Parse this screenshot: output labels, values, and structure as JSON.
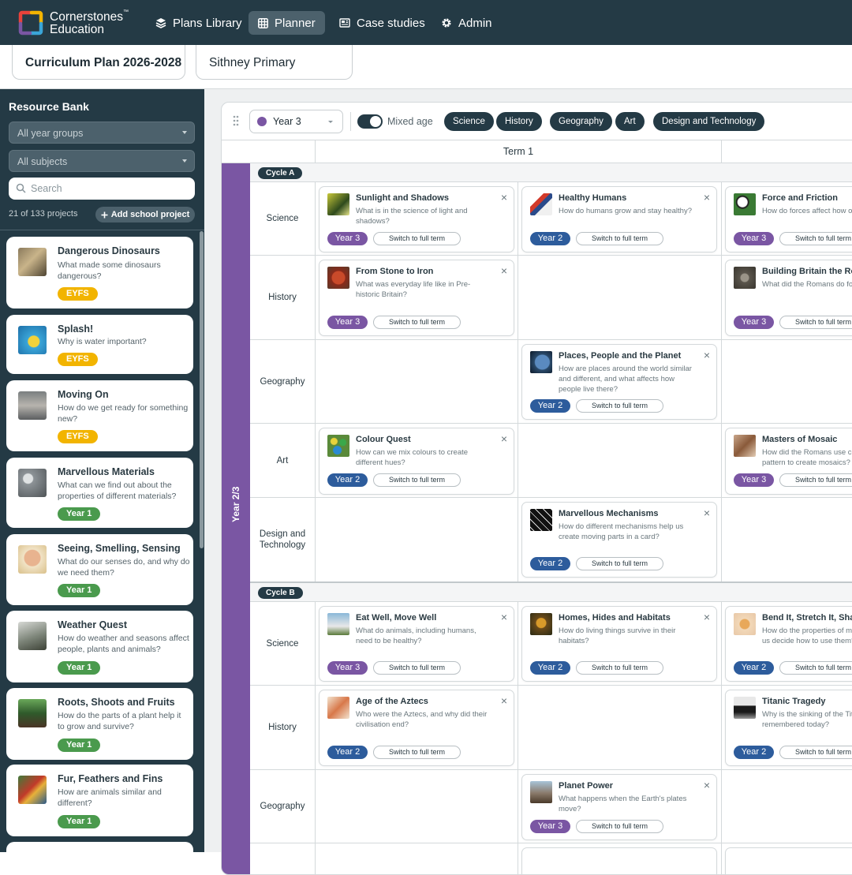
{
  "brand": {
    "line1": "Cornerstones",
    "tm": "™",
    "line2": "Education"
  },
  "nav": [
    {
      "label": "Plans Library",
      "icon": "layers-icon"
    },
    {
      "label": "Planner",
      "icon": "grid-icon",
      "active": true
    },
    {
      "label": "Case studies",
      "icon": "newspaper-icon"
    },
    {
      "label": "Admin",
      "icon": "gear-icon"
    }
  ],
  "plan": {
    "title": "Curriculum Plan 2026-2028",
    "school": "Sithney Primary"
  },
  "sidebar": {
    "title": "Resource Bank",
    "year_filter": "All year groups",
    "subject_filter": "All subjects",
    "search_placeholder": "Search",
    "count": "21 of 133 projects",
    "add_label": "Add school project",
    "items": [
      {
        "title": "Dangerous Dinosaurs",
        "question": "What made some dinosaurs dangerous?",
        "badge": "EYFS"
      },
      {
        "title": "Splash!",
        "question": "Why is water important?",
        "badge": "EYFS"
      },
      {
        "title": "Moving On",
        "question": "How do we get ready for something new?",
        "badge": "EYFS"
      },
      {
        "title": "Marvellous Materials",
        "question": "What can we find out about the properties of different materials?",
        "badge": "Year 1"
      },
      {
        "title": "Seeing, Smelling, Sensing",
        "question": "What do our senses do, and why do we need them?",
        "badge": "Year 1"
      },
      {
        "title": "Weather Quest",
        "question": "How do weather and seasons affect people, plants and animals?",
        "badge": "Year 1"
      },
      {
        "title": "Roots, Shoots and Fruits",
        "question": "How do the parts of a plant help it to grow and survive?",
        "badge": "Year 1"
      },
      {
        "title": "Fur, Feathers and Fins",
        "question": "How are animals similar and different?",
        "badge": "Year 1"
      }
    ]
  },
  "toolbar": {
    "year": "Year 3",
    "mixed_age": "Mixed age",
    "subjects": [
      "Science",
      "History",
      "Geography",
      "Art",
      "Design and Technology"
    ]
  },
  "term": "Term 1",
  "year_band": "Year 2/3",
  "switch_label": "Switch to full term",
  "close_glyph": "×",
  "cycles": [
    {
      "label": "Cycle A",
      "rows": [
        {
          "subject": "Science",
          "cards": [
            {
              "title": "Sunlight and Shadows",
              "question": "What is in the science of light and shadows?",
              "year": "Year 3"
            },
            {
              "title": "Healthy Humans",
              "question": "How do humans grow and stay healthy?",
              "year": "Year 2"
            },
            {
              "title": "Force and Friction",
              "question": "How do forces affect how objects move?",
              "year": "Year 3"
            }
          ]
        },
        {
          "subject": "History",
          "cards": [
            {
              "title": "From Stone to Iron",
              "question": "What was everyday life like in Pre-historic Britain?",
              "year": "Year 3"
            },
            {
              "title": "Building Britain the Romans",
              "question": "What did the Romans do for Britain?",
              "year": "Year 3"
            }
          ]
        },
        {
          "subject": "Geography",
          "cards": [
            {
              "title": "Places, People and the Planet",
              "question": "How are places around the world similar and different, and what affects how people live there?",
              "year": "Year 2"
            }
          ]
        },
        {
          "subject": "Art",
          "cards": [
            {
              "title": "Colour Quest",
              "question": "How can we mix colours to create different hues?",
              "year": "Year 2"
            },
            {
              "title": "Masters of Mosaic",
              "question": "How did the Romans use colour and pattern to create mosaics?",
              "year": "Year 3"
            }
          ]
        },
        {
          "subject": "Design and Technology",
          "cards": [
            {
              "title": "Marvellous Mechanisms",
              "question": "How do different mechanisms help us create moving parts in a card?",
              "year": "Year 2"
            }
          ]
        }
      ]
    },
    {
      "label": "Cycle B",
      "rows": [
        {
          "subject": "Science",
          "cards": [
            {
              "title": "Eat Well, Move Well",
              "question": "What do animals, including humans, need to be healthy?",
              "year": "Year 3"
            },
            {
              "title": "Homes, Hides and Habitats",
              "question": "How do living things survive in their habitats?",
              "year": "Year 2"
            },
            {
              "title": "Bend It, Stretch It, Shape It",
              "question": "How do the properties of materials help us decide how to use them?",
              "year": "Year 2"
            }
          ]
        },
        {
          "subject": "History",
          "cards": [
            {
              "title": "Age of the Aztecs",
              "question": "Who were the Aztecs, and why did their civilisation end?",
              "year": "Year 2"
            },
            {
              "title": "Titanic Tragedy",
              "question": "Why is the sinking of the Titanic remembered today?",
              "year": "Year 2"
            }
          ]
        },
        {
          "subject": "Geography",
          "cards": [
            {
              "title": "Planet Power",
              "question": "What happens when the Earth's plates move?",
              "year": "Year 3"
            }
          ]
        }
      ]
    }
  ]
}
